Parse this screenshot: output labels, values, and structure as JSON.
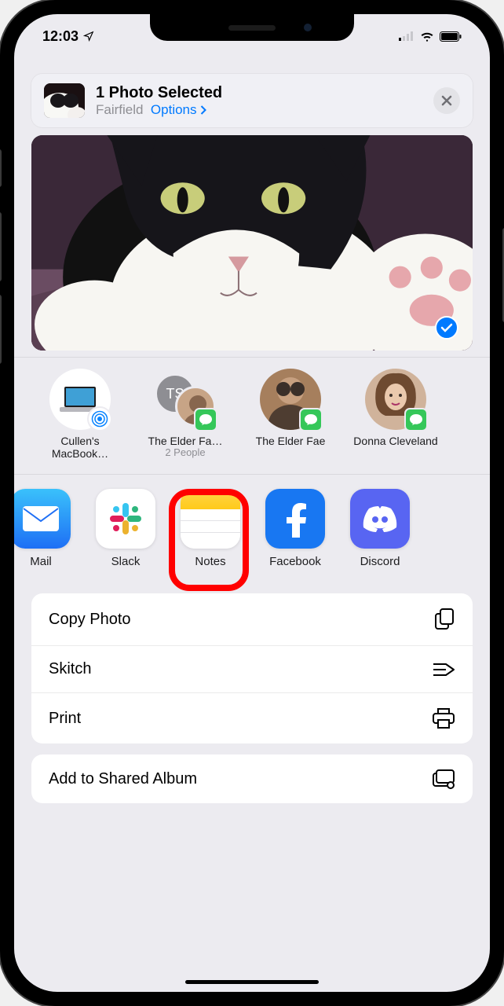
{
  "statusbar": {
    "time": "12:03"
  },
  "header": {
    "title": "1 Photo Selected",
    "location": "Fairfield",
    "options_label": "Options"
  },
  "contacts": [
    {
      "name": "Cullen's MacBook…",
      "sub": "",
      "avatar_type": "device",
      "initials": ""
    },
    {
      "name": "The Elder Fa…",
      "sub": "2 People",
      "avatar_type": "group",
      "initials": "TS"
    },
    {
      "name": "The Elder Fae",
      "sub": "",
      "avatar_type": "photo",
      "initials": ""
    },
    {
      "name": "Donna Cleveland",
      "sub": "",
      "avatar_type": "photo",
      "initials": ""
    }
  ],
  "apps": [
    {
      "label": "Mail",
      "key": "mail"
    },
    {
      "label": "Slack",
      "key": "slack"
    },
    {
      "label": "Notes",
      "key": "notes"
    },
    {
      "label": "Facebook",
      "key": "facebook"
    },
    {
      "label": "Discord",
      "key": "discord"
    }
  ],
  "actions": [
    {
      "label": "Copy Photo",
      "icon": "copy"
    },
    {
      "label": "Skitch",
      "icon": "skitch"
    },
    {
      "label": "Print",
      "icon": "print"
    }
  ],
  "actions2": [
    {
      "label": "Add to Shared Album",
      "icon": "shared"
    }
  ],
  "highlight_app_index": 2
}
